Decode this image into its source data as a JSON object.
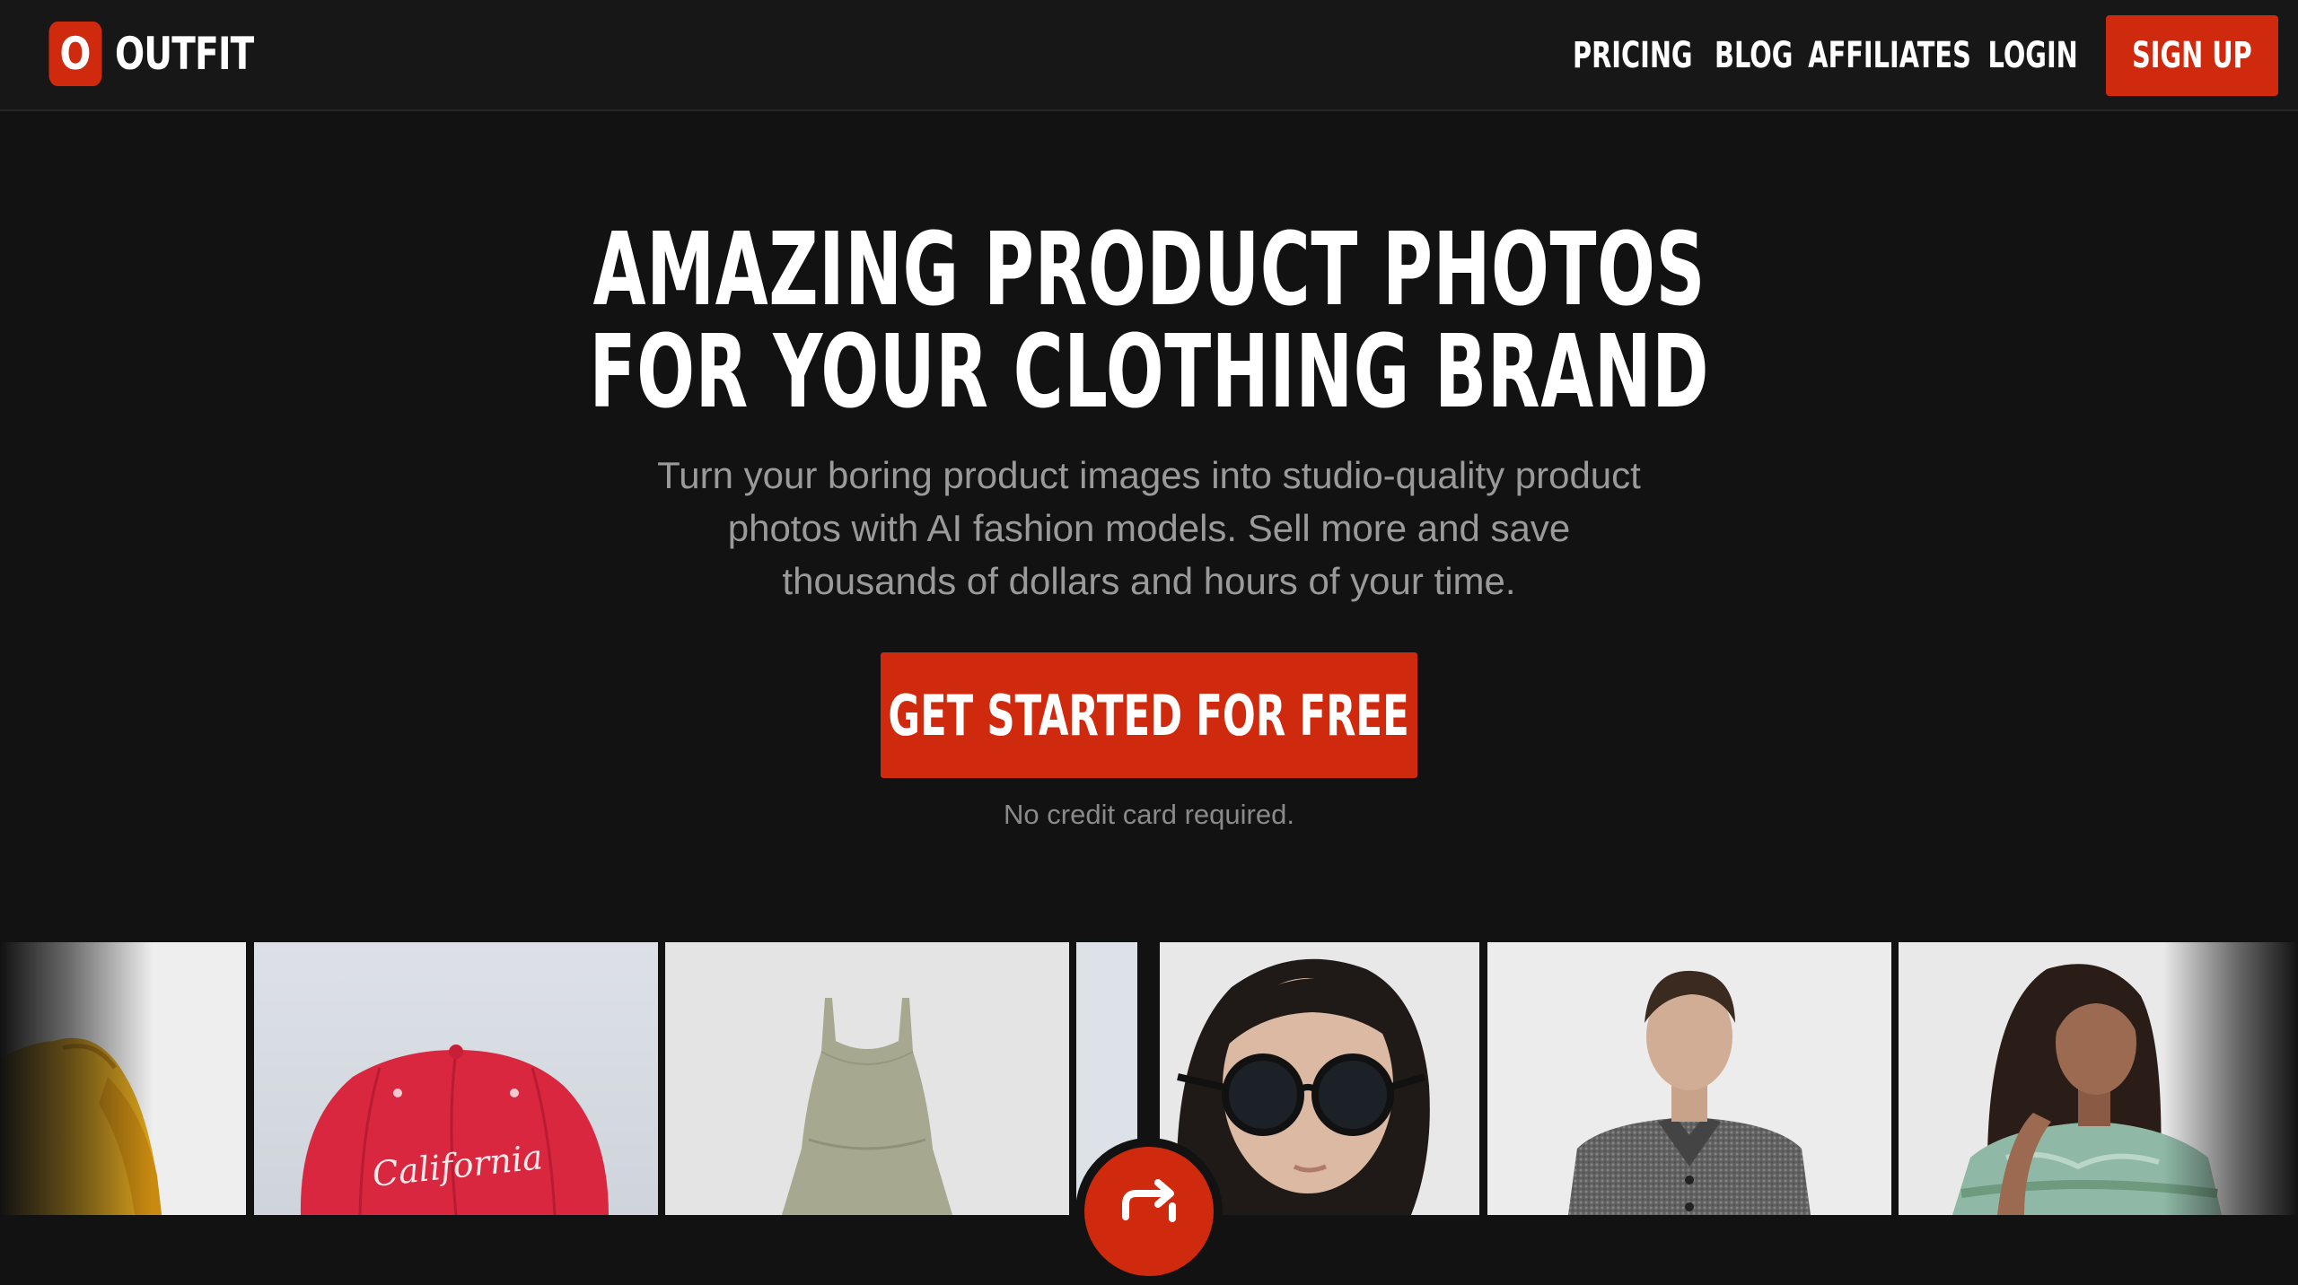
{
  "brand": {
    "logo_mark": "O",
    "name": "OUTFIT",
    "accent_color": "#cf2a0e"
  },
  "nav": {
    "links": [
      "PRICING",
      "BLOG",
      "AFFILIATES",
      "LOGIN"
    ],
    "signup_label": "SIGN UP"
  },
  "hero": {
    "title_line1": "AMAZING PRODUCT PHOTOS",
    "title_line2": "FOR YOUR CLOTHING BRAND",
    "subtitle": "Turn your boring product images into studio-quality product photos with AI fashion models. Sell more and save thousands of dollars and hours of your time.",
    "cta_label": "GET STARTED FOR FREE",
    "cta_note": "No credit card required."
  },
  "gallery": {
    "hat_text": "California",
    "items": [
      "yellow-puffer-jacket",
      "red-cap",
      "sage-dress",
      "model-sunglasses",
      "model-tweed-jacket",
      "model-knit-sweater"
    ],
    "switch_icon": "swap-arrow-icon"
  }
}
